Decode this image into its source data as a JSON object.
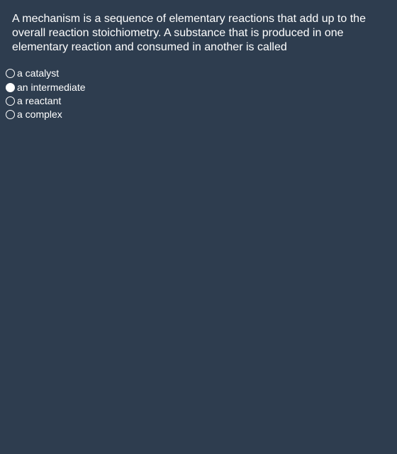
{
  "question": {
    "text": "A mechanism is a sequence of elementary reactions that add up to the overall reaction stoichiometry. A substance that is produced in one elementary reaction and consumed in another is called"
  },
  "options": [
    {
      "label": "a catalyst",
      "selected": false
    },
    {
      "label": "an intermediate",
      "selected": true
    },
    {
      "label": "a reactant",
      "selected": false
    },
    {
      "label": "a complex",
      "selected": false
    }
  ],
  "colors": {
    "background": "#2e3d4f",
    "text": "#ffffff"
  }
}
